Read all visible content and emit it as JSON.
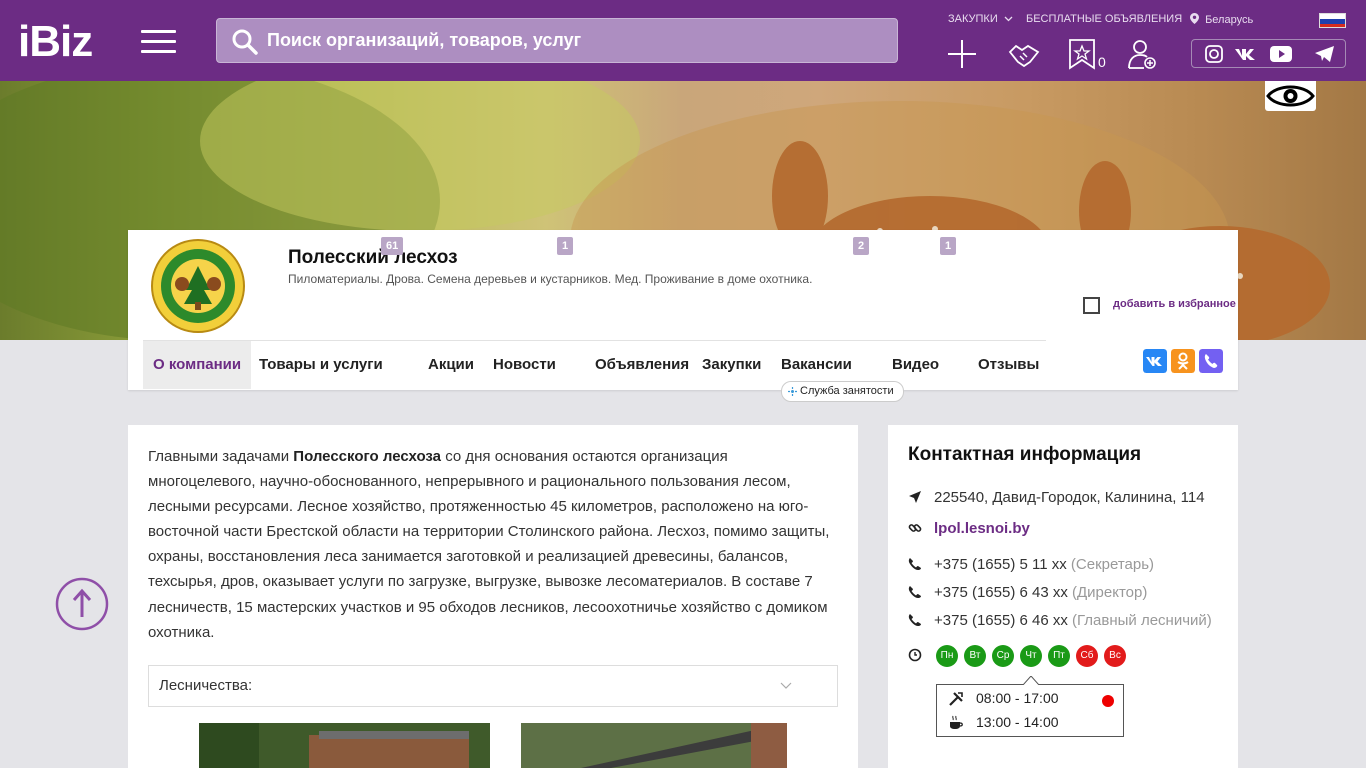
{
  "header": {
    "logo": "iBiz",
    "search_placeholder": "Поиск организаций, товаров, услуг",
    "links": {
      "purchases": "ЗАКУПКИ",
      "free_ads": "БЕСПЛАТНЫЕ ОБЪЯВЛЕНИЯ",
      "region": "Беларусь"
    },
    "favorites_count": "0",
    "icons": [
      "plus-icon",
      "handshake-icon",
      "favorites-star-icon",
      "add-user-icon"
    ],
    "social": [
      "instagram-icon",
      "vk-icon",
      "youtube-icon",
      "telegram-icon"
    ]
  },
  "company": {
    "name": "Полесский лесхоз",
    "description": "Пиломатериалы. Дрова. Семена деревьев и кустарников. Мед. Проживание в доме охотника.",
    "add_favorite": "добавить в избранное"
  },
  "tabs": [
    {
      "label": "О компании",
      "badge": ""
    },
    {
      "label": "Товары и услуги",
      "badge": "61"
    },
    {
      "label": "Акции",
      "badge": ""
    },
    {
      "label": "Новости",
      "badge": "1"
    },
    {
      "label": "Объявления",
      "badge": ""
    },
    {
      "label": "Закупки",
      "badge": ""
    },
    {
      "label": "Вакансии",
      "badge": "2"
    },
    {
      "label": "Видео",
      "badge": "1"
    },
    {
      "label": "Отзывы",
      "badge": ""
    }
  ],
  "employment_service": "Служба занятости",
  "about": {
    "text_before": "Главными задачами ",
    "text_bold": "Полесского лесхоза",
    "text_after": " со дня основания остаются  организация многоцелевого, научно-обоснованного, непрерывного и рационального пользования лесом, лесными ресурсами. Лесное хозяйство, протяженностью 45 километров, расположено на юго-восточной части Брестской области на территории Столинского района. Лесхоз, помимо защиты, охраны, восстановления леса занимается заготовкой и реализацией древесины, балансов, техсырья, дров, оказывает услуги по загрузке, выгрузке, вывозке лесоматериалов. В составе 7 лесничеств, 15 мастерских участков и 95 обходов лесников, лесоохотничье хозяйство с домиком охотника.",
    "dropdown_label": "Лесничества:"
  },
  "contact": {
    "title": "Контактная информация",
    "address": "225540, Давид-Городок, Калинина, 114",
    "website": "lpol.lesnoi.by",
    "phones": [
      {
        "number": "+375 (1655) 5 11 xx",
        "note": "(Секретарь)"
      },
      {
        "number": "+375 (1655) 6 43 xx",
        "note": "(Директор)"
      },
      {
        "number": "+375 (1655) 6 46 xx",
        "note": "(Главный лесничий)"
      }
    ],
    "days": [
      "Пн",
      "Вт",
      "Ср",
      "Чт",
      "Пт",
      "Сб",
      "Вс"
    ],
    "work_hours": "08:00 - 17:00",
    "lunch_hours": "13:00 - 14:00"
  },
  "colors": {
    "brand": "#6c2c84",
    "open_day": "#1a9a16",
    "closed_day": "#e21b1b"
  }
}
